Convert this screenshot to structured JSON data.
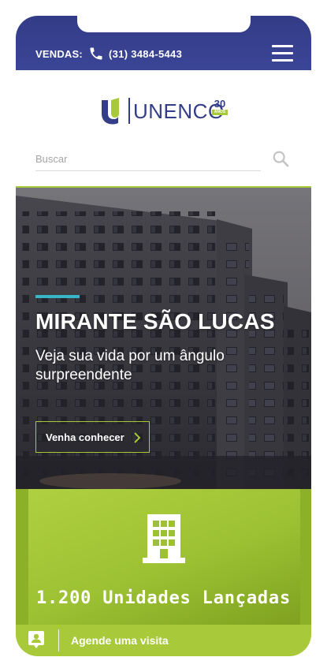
{
  "header": {
    "sales_label": "VENDAS:",
    "phone": "(31) 3484-5443",
    "menu_icon": "hamburger-menu-icon",
    "background": "#363f8d"
  },
  "logo": {
    "brand": "UNENCO",
    "anniversary_number": "30",
    "anniversary_label": "ANOS",
    "brand_color": "#343d87",
    "accent_color": "#a7c93a"
  },
  "search": {
    "placeholder": "Buscar",
    "value": "",
    "icon": "search-icon"
  },
  "hero": {
    "title": "MIRANTE SÃO LUCAS",
    "subtitle": "Veja sua vida por um ângulo surpreendente",
    "cta_label": "Venha conhecer",
    "accent_color": "#38b4c8"
  },
  "stats": {
    "icon": "building-icon",
    "value": "1.200 Unidades Lançadas",
    "background": "#9cc133"
  },
  "bottom_bar": {
    "icon": "calendar-person-icon",
    "label": "Agende uma visita"
  }
}
